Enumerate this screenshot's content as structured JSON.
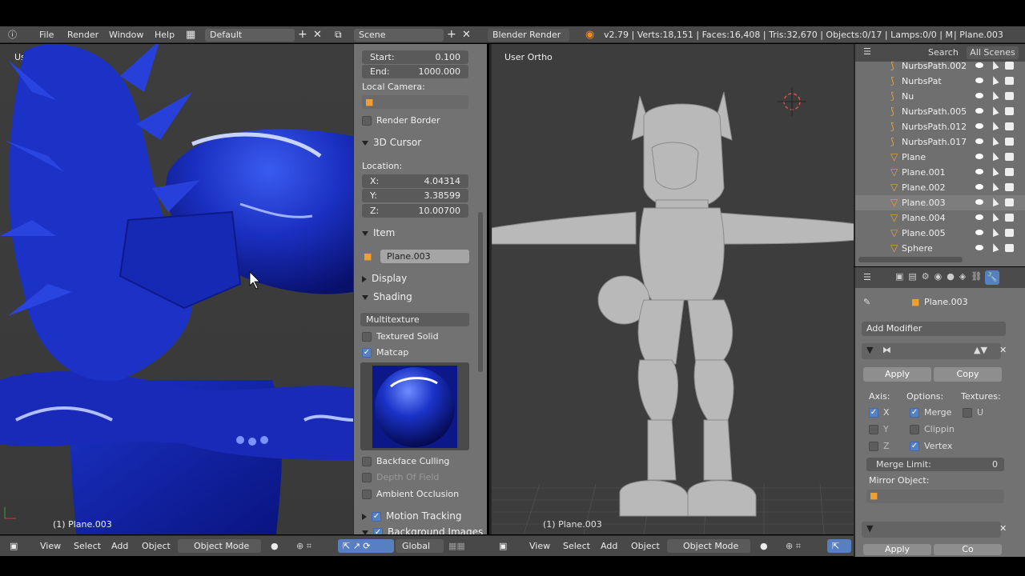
{
  "topbar": {
    "menus": [
      "File",
      "Render",
      "Window",
      "Help"
    ],
    "layout": "Default",
    "scene": "Scene",
    "engine": "Blender Render",
    "stats": "v2.79 | Verts:18,151 | Faces:16,408 | Tris:32,670 | Objects:0/17 | Lamps:0/0 | M",
    "active": "| Plane.003"
  },
  "left_view": {
    "label": "User Ortho",
    "object_label": "(1) Plane.003"
  },
  "right_view": {
    "label": "User Ortho",
    "object_label": "(1) Plane.003"
  },
  "npanel": {
    "clip_start_label": "Start:",
    "clip_start": "0.100",
    "clip_end_label": "End:",
    "clip_end": "1000.000",
    "local_camera": "Local Camera:",
    "render_border": "Render Border",
    "cursor_header": "3D Cursor",
    "location": "Location:",
    "x_label": "X:",
    "x": "4.04314",
    "y_label": "Y:",
    "y": "3.38599",
    "z_label": "Z:",
    "z": "10.00700",
    "item_header": "Item",
    "item_name": "Plane.003",
    "display_header": "Display",
    "shading_header": "Shading",
    "shading_mode": "Multitexture",
    "textured_solid": "Textured Solid",
    "matcap": "Matcap",
    "backface": "Backface Culling",
    "dof": "Depth Of Field",
    "ao": "Ambient Occlusion",
    "motion_tracking": "Motion Tracking",
    "bg_images": "Background Images"
  },
  "bottom_left": {
    "menus": [
      "View",
      "Select",
      "Add",
      "Object"
    ],
    "mode": "Object Mode",
    "orientation": "Global"
  },
  "bottom_right": {
    "menus": [
      "View",
      "Select",
      "Add",
      "Object"
    ],
    "mode": "Object Mode"
  },
  "outliner": {
    "search": "Search",
    "all_scenes": "All Scenes",
    "items": [
      {
        "name": "NurbsPath.002",
        "type": "curve"
      },
      {
        "name": "NurbsPat",
        "type": "curve"
      },
      {
        "name": "Nu",
        "type": "curve"
      },
      {
        "name": "NurbsPath.005",
        "type": "curve"
      },
      {
        "name": "NurbsPath.012",
        "type": "curve"
      },
      {
        "name": "NurbsPath.017",
        "type": "curve"
      },
      {
        "name": "Plane",
        "type": "mesh"
      },
      {
        "name": "Plane.001",
        "type": "mesh"
      },
      {
        "name": "Plane.002",
        "type": "mesh"
      },
      {
        "name": "Plane.003",
        "type": "mesh"
      },
      {
        "name": "Plane.004",
        "type": "mesh"
      },
      {
        "name": "Plane.005",
        "type": "mesh"
      },
      {
        "name": "Sphere",
        "type": "mesh"
      }
    ]
  },
  "props": {
    "object_name": "Plane.003",
    "add_modifier": "Add Modifier",
    "apply": "Apply",
    "copy": "Copy",
    "axis": "Axis:",
    "options": "Options:",
    "textures": "Textures:",
    "ax_x": "X",
    "ax_y": "Y",
    "ax_z": "Z",
    "merge": "Merge",
    "clipping": "Clippin",
    "vertex": "Vertex",
    "tex_u": "U",
    "merge_limit": "Merge Limit:",
    "merge_limit_value": "0",
    "mirror_object": "Mirror Object:",
    "apply2": "Apply",
    "copy2": "Co"
  },
  "colors": {
    "panel": "#727272",
    "viewport": "#3d3d3d",
    "accent": "#5680c2",
    "mesh_blue": "#1a2fc0",
    "mesh_grey": "#b8b8b8"
  }
}
